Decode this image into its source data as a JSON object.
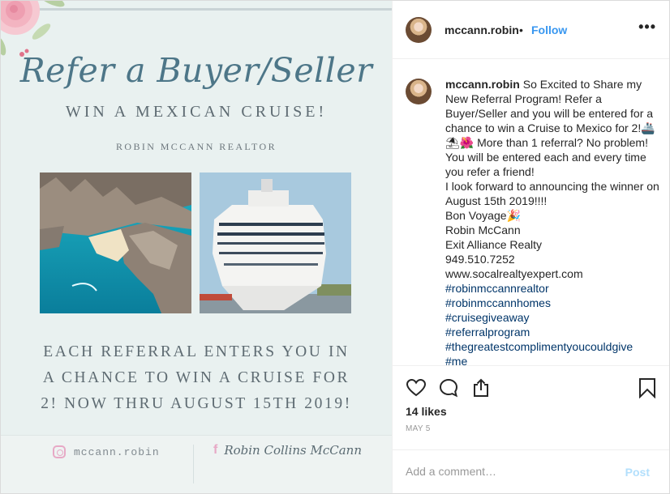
{
  "post": {
    "title_script": "Refer a Buyer/Seller",
    "subtitle": "WIN A MEXICAN CRUISE!",
    "realtor": "ROBIN MCCANN REALTOR",
    "body_lines": [
      "EACH REFERRAL ENTERS YOU IN",
      "A CHANCE TO WIN A CRUISE FOR",
      "2! NOW THRU AUGUST 15TH 2019!"
    ],
    "footer_instagram": "mccann.robin",
    "footer_facebook": "Robin Collins McCann"
  },
  "header": {
    "username": "mccann.robin",
    "separator": "•",
    "follow_label": "Follow",
    "more_icon": "more-options-icon",
    "more_label": "•••"
  },
  "caption": {
    "username": "mccann.robin",
    "text": "So Excited to Share my New Referral Program! Refer a Buyer/Seller and you will be entered for a chance to win a Cruise to Mexico for 2!🚢⛱🌺 More than 1 referral? No problem! You will be entered each and every time you refer a friend!\nI look forward to announcing the winner on August 15th 2019!!!!\nBon Voyage🎉\nRobin McCann\nExit Alliance Realty\n949.510.7252\nwww.socalrealtyexpert.com",
    "hashtags": [
      "#robinmccannrealtor",
      "#robinmccannhomes",
      "#cruisegiveaway",
      "#referralprogram",
      "#thegreatestcomplimentyoucouldgive",
      "#me"
    ]
  },
  "actions": {
    "like_icon": "heart-icon",
    "comment_icon": "comment-icon",
    "share_icon": "share-icon",
    "save_icon": "bookmark-icon",
    "likes": "14 likes",
    "date": "MAY 5"
  },
  "comment": {
    "placeholder": "Add a comment…",
    "post_label": "Post"
  },
  "colors": {
    "accent": "#3897f0",
    "post_disabled": "#b2dffc",
    "hashtag": "#003569",
    "poster_title": "#4d7688"
  }
}
